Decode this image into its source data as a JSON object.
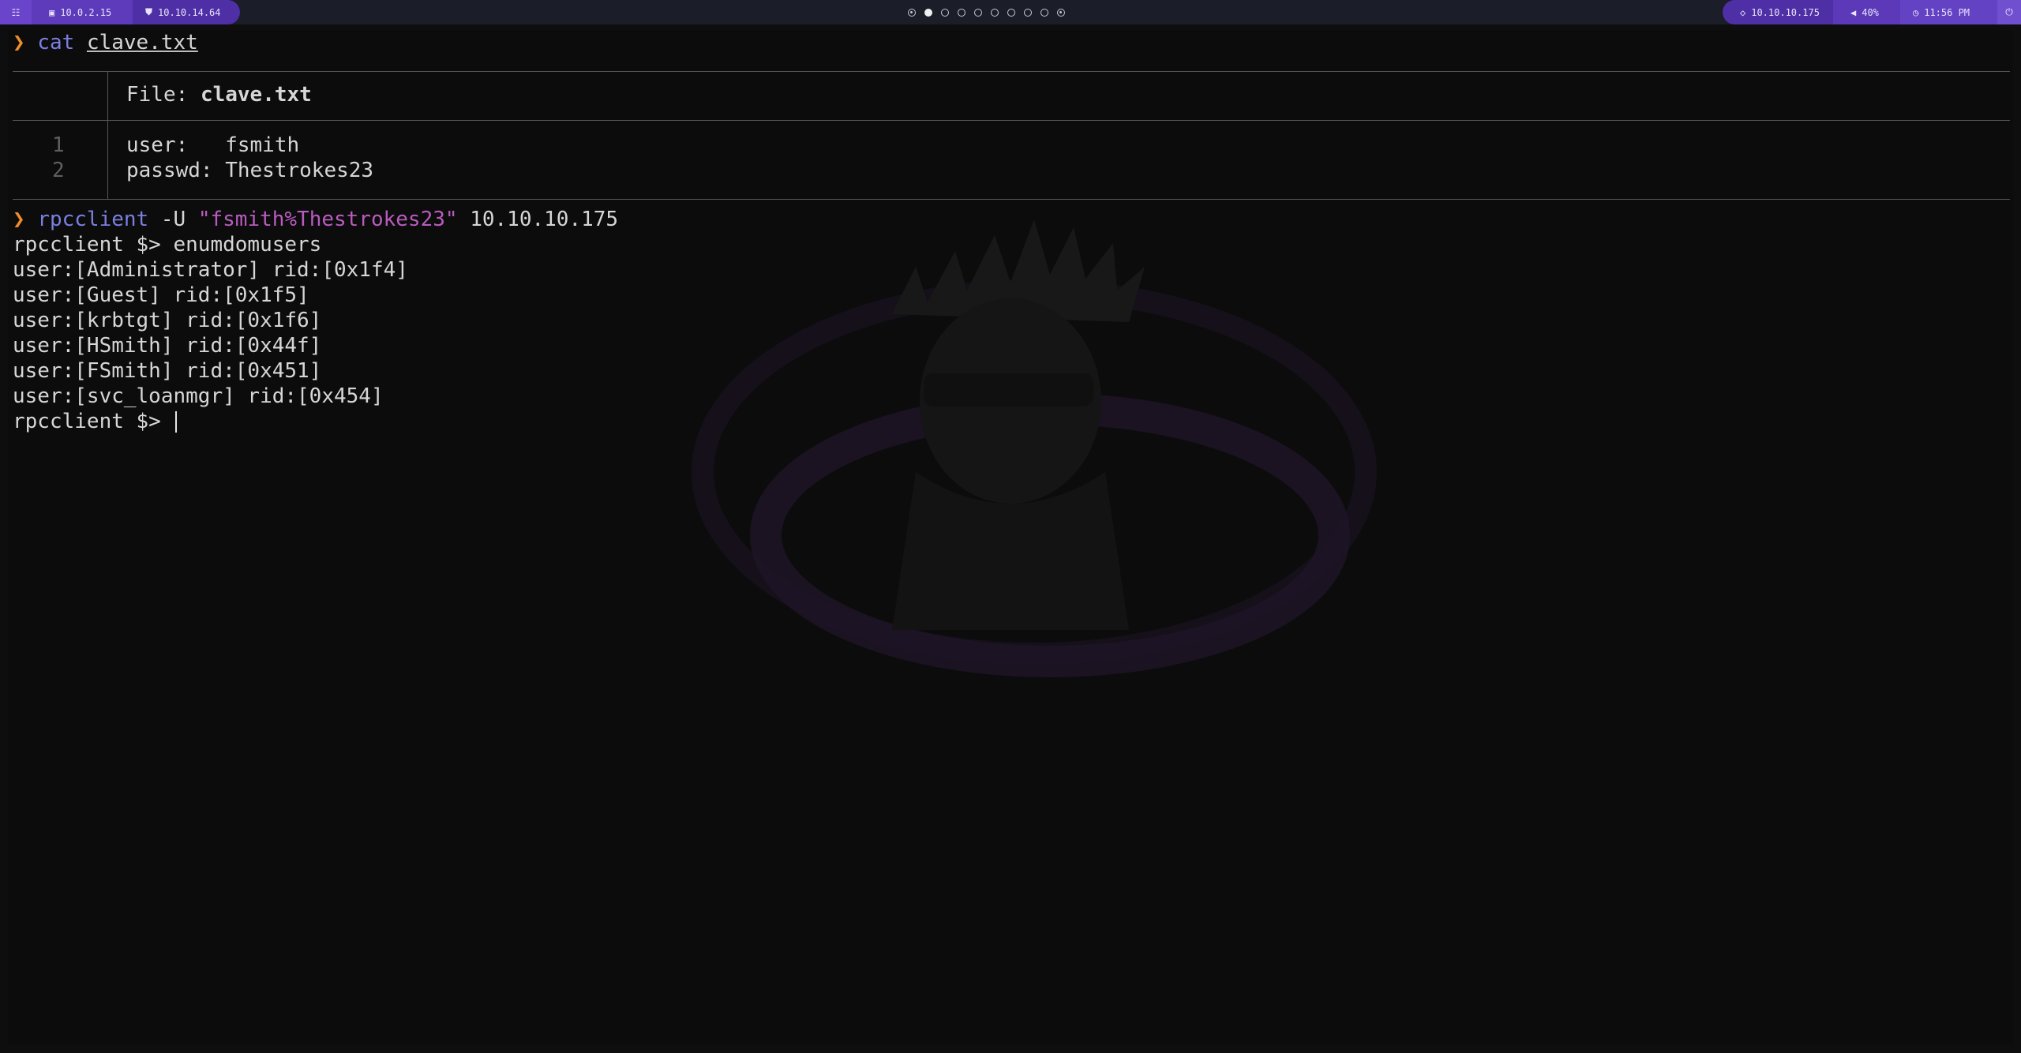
{
  "topbar": {
    "menu_icon": "grid-menu-icon",
    "host_ip": "10.0.2.15",
    "host_icon": "monitor-icon",
    "vpn_ip": "10.10.14.64",
    "vpn_icon": "shield-icon",
    "workspaces": [
      "target-glyph",
      "active",
      "empty",
      "empty",
      "empty",
      "empty",
      "empty",
      "empty",
      "empty",
      "target-glyph"
    ],
    "target_ip": "10.10.10.175",
    "target_icon": "crosshair-icon",
    "volume": "40%",
    "volume_icon": "speaker-icon",
    "time": "11:56 PM",
    "clock_icon": "clock-icon",
    "power_icon": "power-icon"
  },
  "terminal": {
    "prompt_symbol": "❯",
    "cmd1": {
      "program": "cat",
      "file": "clave.txt"
    },
    "bat": {
      "file_label": "File:",
      "file_name": "clave.txt",
      "line_numbers": [
        "1",
        "2"
      ],
      "lines": [
        "user:   fsmith",
        "passwd: Thestrokes23"
      ]
    },
    "cmd2": {
      "program": "rpcclient",
      "flag": "-U",
      "credentials": "\"fsmith%Thestrokes23\"",
      "target": "10.10.10.175"
    },
    "rpc_prompt": "rpcclient $>",
    "rpc_command": "enumdomusers",
    "output": [
      "user:[Administrator] rid:[0x1f4]",
      "user:[Guest] rid:[0x1f5]",
      "user:[krbtgt] rid:[0x1f6]",
      "user:[HSmith] rid:[0x44f]",
      "user:[FSmith] rid:[0x451]",
      "user:[svc_loanmgr] rid:[0x454]"
    ]
  },
  "colors": {
    "prompt": "#ef8d2a",
    "command": "#7a7fe0",
    "string": "#b95bbf",
    "bar_purple": "#5b39b8"
  }
}
